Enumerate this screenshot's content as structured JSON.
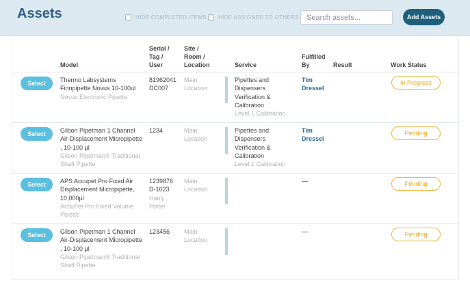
{
  "header": {
    "title": "Assets",
    "hide_completed": "HIDE COMPLETED ITEMS",
    "hide_assigned": "HIDE ASSIGNED TO OTHERS",
    "search_placeholder": "Search assets...",
    "add_label": "Add Assets"
  },
  "columns": {
    "model": "Model",
    "serial": [
      "Serial /",
      "Tag /",
      "User"
    ],
    "site": [
      "Site /",
      "Room /",
      "Location"
    ],
    "service": "Service",
    "fulfilled": [
      "Fulfilled",
      "By"
    ],
    "result": "Result",
    "work_status": "Work Status"
  },
  "rows": [
    {
      "select": "Select",
      "model": [
        "Thermo Labsystems",
        "Finnpipette Novus 10-100ul"
      ],
      "model_sub": [
        "Novus Electronic Pipette"
      ],
      "serial": [
        "81962041",
        "DC007"
      ],
      "site": [
        "Main",
        "Location"
      ],
      "service": [
        "Pipettes and",
        "Dispensers",
        "Verification &",
        "Calibration"
      ],
      "service_sub": "Level 1 Calibration",
      "fulfilled": [
        "Tim",
        "Dressel"
      ],
      "status": "In Progress"
    },
    {
      "select": "Select",
      "model": [
        "Gilson Pipetman 1 Channel",
        "Air-Displacement Micropipette",
        ", 10-100 µl"
      ],
      "model_sub": [
        "Gilson Pipetman® Traditional",
        "Shaft Pipette"
      ],
      "serial": [
        "1234"
      ],
      "site": [
        "Main",
        "Location"
      ],
      "service": [
        "Pipettes and",
        "Dispensers",
        "Verification &",
        "Calibration"
      ],
      "service_sub": "Level 1 Calibration",
      "fulfilled": [
        "Tim",
        "Dressel"
      ],
      "status": "Pending"
    },
    {
      "select": "Select",
      "model": [
        "APS Accupet Pro Fixed Air",
        "Displacement Micropipette,",
        "10,000µl"
      ],
      "model_sub": [
        "AccuPet Pro Fixed Volume",
        "Pipette"
      ],
      "serial": [
        "1239876",
        "D-1023"
      ],
      "serial_sub": [
        "Harry",
        "Potter"
      ],
      "site": [
        "Main",
        "Location"
      ],
      "fulfilled_dash": "---",
      "status": "Pending"
    },
    {
      "select": "Select",
      "model": [
        "Gilson Pipetman 1 Channel",
        "Air-Displacement Micropipette",
        ", 10-100 µl"
      ],
      "model_sub": [
        "Gilson Pipetman® Traditional",
        "Shaft Pipette"
      ],
      "serial": [
        "123456"
      ],
      "site": [
        "Main",
        "Location"
      ],
      "fulfilled_dash": "---",
      "status": "Pending"
    }
  ]
}
